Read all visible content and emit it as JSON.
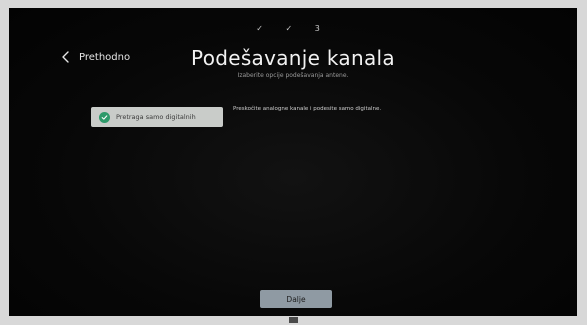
{
  "steps": [
    "✓",
    "✓",
    "3"
  ],
  "header": {
    "back_label": "Prethodno",
    "title": "Podešavanje kanala",
    "subtitle": "Izaberite opcije podešavanja antene."
  },
  "option": {
    "label": "Pretraga samo digitalnih",
    "selected": true,
    "check_color": "#2e9a6a"
  },
  "description": "Preskočite analogne kanale i podesite samo digitalne.",
  "footer": {
    "next_label": "Dalje"
  }
}
